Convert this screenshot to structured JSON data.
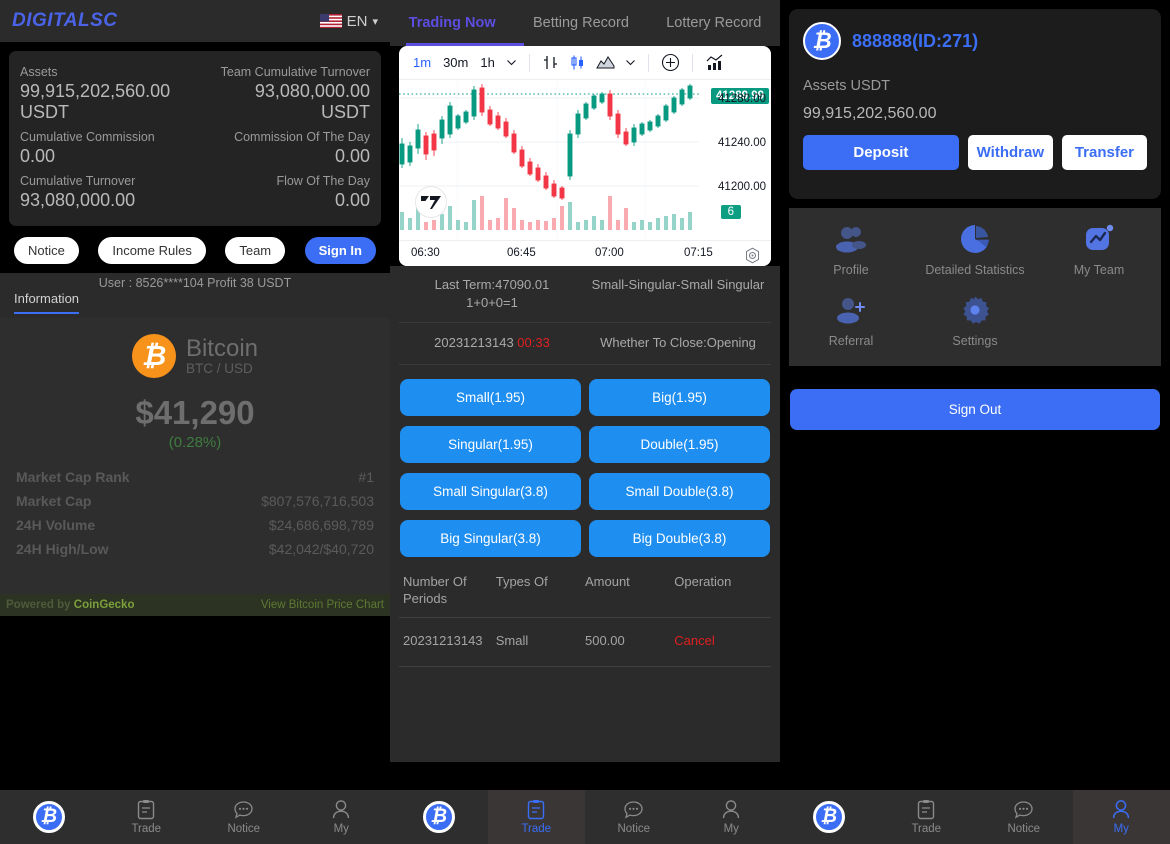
{
  "left": {
    "brand": "DIGITALSC",
    "language": "EN",
    "flag_icon": "us-flag-icon",
    "assets": {
      "label_assets": "Assets",
      "value_assets": "99,915,202,560.00 USDT",
      "label_team_turnover": "Team Cumulative Turnover",
      "value_team_turnover": "93,080,000.00 USDT",
      "label_cum_commission": "Cumulative Commission",
      "value_cum_commission": "0.00",
      "label_commission_day": "Commission Of The Day",
      "value_commission_day": "0.00",
      "label_cum_turnover": "Cumulative Turnover",
      "value_cum_turnover": "93,080,000.00",
      "label_flow_day": "Flow Of The Day",
      "value_flow_day": "0.00"
    },
    "buttons": {
      "notice": "Notice",
      "income_rules": "Income Rules",
      "team": "Team",
      "sign_in": "Sign In"
    },
    "marquee": "User : 8526****104 Profit 38 USDT",
    "tab_information": "Information",
    "coin": {
      "name": "Bitcoin",
      "pair": "BTC / USD",
      "price": "$41,290",
      "change": "(0.28%)",
      "stats": [
        {
          "label": "Market Cap Rank",
          "value": "#1"
        },
        {
          "label": "Market Cap",
          "value": "$807,576,716,503"
        },
        {
          "label": "24H Volume",
          "value": "$24,686,698,789"
        },
        {
          "label": "24H High/Low",
          "value": "$42,042/$40,720"
        }
      ],
      "powered_by": "Powered by",
      "powered_brand": "CoinGecko",
      "view_chart_link": "View Bitcoin Price Chart"
    }
  },
  "middle": {
    "tabs": [
      {
        "label": "Trading Now",
        "active": true
      },
      {
        "label": "Betting Record",
        "active": false
      },
      {
        "label": "Lottery Record",
        "active": false
      }
    ],
    "chart_toolbar": {
      "timeframes": [
        "1m",
        "30m",
        "1h"
      ],
      "active_timeframe": "1m",
      "more_icon": "chevron-down-icon",
      "bar_style_icon": "bar-chart-icon",
      "candle_style_icon": "candlestick-icon",
      "area_style_icon": "mountain-area-icon",
      "style_caret_icon": "chevron-down-icon",
      "indicators_icon": "plus-circle-icon",
      "compare_icon": "compare-chart-icon"
    },
    "chart": {
      "current_price_badge": "41289.99",
      "volume_badge": "6",
      "axis_ticks": [
        "41280.00",
        "41240.00",
        "41200.00"
      ],
      "time_ticks": [
        "06:30",
        "06:45",
        "07:00",
        "07:15"
      ],
      "watermark": "TradingView",
      "crosshair_icon": "crosshair-target-icon"
    },
    "term": {
      "last_term": "Last Term:47090.01",
      "last_sum": "1+0+0=1",
      "result": "Small-Singular-Small Singular",
      "period_no": "20231213143",
      "countdown": "00:33",
      "close_status": "Whether To Close:Opening"
    },
    "bet_buttons": [
      "Small(1.95)",
      "Big(1.95)",
      "Singular(1.95)",
      "Double(1.95)",
      "Small Singular(3.8)",
      "Small Double(3.8)",
      "Big Singular(3.8)",
      "Big Double(3.8)"
    ],
    "table": {
      "headers": [
        "Number Of Periods",
        "Types Of",
        "Amount",
        "Operation"
      ],
      "rows": [
        {
          "period": "20231213143",
          "type": "Small",
          "amount": "500.00",
          "operation": "Cancel"
        }
      ]
    }
  },
  "right": {
    "user": {
      "avatar_icon": "bitcoin-avatar-icon",
      "name": "888888(ID:271)",
      "assets_label": "Assets USDT",
      "assets_value": "99,915,202,560.00",
      "deposit": "Deposit",
      "withdraw": "Withdraw",
      "transfer": "Transfer"
    },
    "menu": [
      {
        "label": "Profile",
        "icon": "users-profile-icon"
      },
      {
        "label": "Detailed Statistics",
        "icon": "pie-chart-icon"
      },
      {
        "label": "My Team",
        "icon": "team-trend-icon"
      },
      {
        "label": "Referral",
        "icon": "user-plus-icon"
      },
      {
        "label": "Settings",
        "icon": "gear-icon"
      }
    ],
    "sign_out": "Sign Out"
  },
  "bottom_nav": {
    "segments": [
      {
        "items": [
          {
            "label": "",
            "icon": "bitcoin-coin-icon",
            "active": false,
            "type": "coin"
          },
          {
            "label": "Trade",
            "icon": "clipboard-icon",
            "active": false,
            "type": "normal"
          },
          {
            "label": "Notice",
            "icon": "chat-bubble-icon",
            "active": false,
            "type": "normal"
          },
          {
            "label": "My",
            "icon": "person-icon",
            "active": false,
            "type": "normal"
          }
        ]
      },
      {
        "items": [
          {
            "label": "",
            "icon": "bitcoin-coin-icon",
            "active": false,
            "type": "coin"
          },
          {
            "label": "Trade",
            "icon": "clipboard-icon",
            "active": true,
            "type": "normal"
          },
          {
            "label": "Notice",
            "icon": "chat-bubble-icon",
            "active": false,
            "type": "normal"
          },
          {
            "label": "My",
            "icon": "person-icon",
            "active": false,
            "type": "normal"
          }
        ]
      },
      {
        "items": [
          {
            "label": "",
            "icon": "bitcoin-coin-icon",
            "active": false,
            "type": "coin"
          },
          {
            "label": "Trade",
            "icon": "clipboard-icon",
            "active": false,
            "type": "normal"
          },
          {
            "label": "Notice",
            "icon": "chat-bubble-icon",
            "active": false,
            "type": "normal"
          },
          {
            "label": "My",
            "icon": "person-icon",
            "active": true,
            "type": "normal"
          }
        ]
      }
    ]
  },
  "colors": {
    "brand_blue": "#4a63e7",
    "accent_blue": "#3b6ef5",
    "bet_blue": "#1f8ef1",
    "tab_purple": "#5b4ee0",
    "bitcoin_orange": "#f7931a",
    "up_green": "#089981",
    "down_red": "#f23645",
    "alert_red": "#e02020",
    "panel_bg": "#2b2b2b",
    "card_bg": "#242424"
  }
}
